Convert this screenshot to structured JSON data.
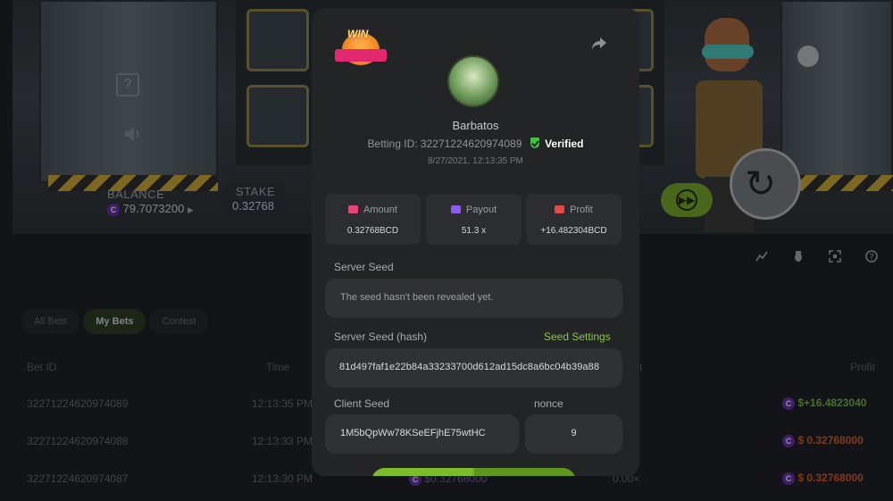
{
  "game": {
    "help_glyph": "?",
    "balance_label": "BALANCE",
    "balance_value": "79.7073200",
    "coin_glyph": "C",
    "stake_label": "STAKE",
    "stake_value": "0.32768",
    "play_glyph": "▶",
    "ff_glyph": "▶▶",
    "spin_glyph": "↻"
  },
  "toolbar": {
    "icons": [
      "chart-icon",
      "bug-icon",
      "fullscreen-icon",
      "help-icon"
    ]
  },
  "bets_tabs": {
    "all": "All Bets",
    "mine": "My Bets",
    "contest": "Contest"
  },
  "table": {
    "headers": {
      "bet_id": "Bet ID",
      "time": "Time",
      "payout": "t",
      "profit": "Profit"
    },
    "rows": [
      {
        "bet_id": "32271224620974089",
        "time": "12:13:35 PM",
        "profit": "$+16.4823040",
        "profit_color": "#7cc04a"
      },
      {
        "bet_id": "32271224620974088",
        "time": "12:13:33 PM",
        "profit": "$ 0.32768000",
        "profit_color": "#e0602a"
      },
      {
        "bet_id": "32271224620974087",
        "time": "12:13:30 PM",
        "amount": "$0.32768000",
        "payout": "0.00×",
        "profit": "$ 0.32768000",
        "profit_color": "#e0602a"
      }
    ]
  },
  "modal": {
    "badge_text": "WIN",
    "username": "Barbatos",
    "betting_id_label": "Betting ID:",
    "betting_id": "322712246209740​89",
    "verified": "Verified",
    "timestamp": "8/27/2021, 12:13:35 PM",
    "stats": {
      "amount_label": "Amount",
      "amount_value": "0.32768BCD",
      "payout_label": "Payout",
      "payout_value": "51.3 x",
      "profit_label": "Profit",
      "profit_value": "+16.482304BCD"
    },
    "server_seed_label": "Server Seed",
    "server_seed_value": "The seed hasn't been revealed yet.",
    "server_seed_hash_label": "Server Seed (hash)",
    "seed_settings": "Seed Settings",
    "server_seed_hash": "81d497faf1e22b84a33233700d612ad15dc8a6bc04b39a88",
    "client_seed_label": "Client Seed",
    "client_seed_value": "1M5bQpWw78KSeEFjhE75wtHC",
    "nonce_label": "nonce",
    "nonce_value": "9"
  },
  "colors": {
    "accent_green": "#8dc63f",
    "amount_icon": "#e8457a",
    "payout_icon": "#8a5cf0",
    "profit_icon": "#e54848"
  }
}
